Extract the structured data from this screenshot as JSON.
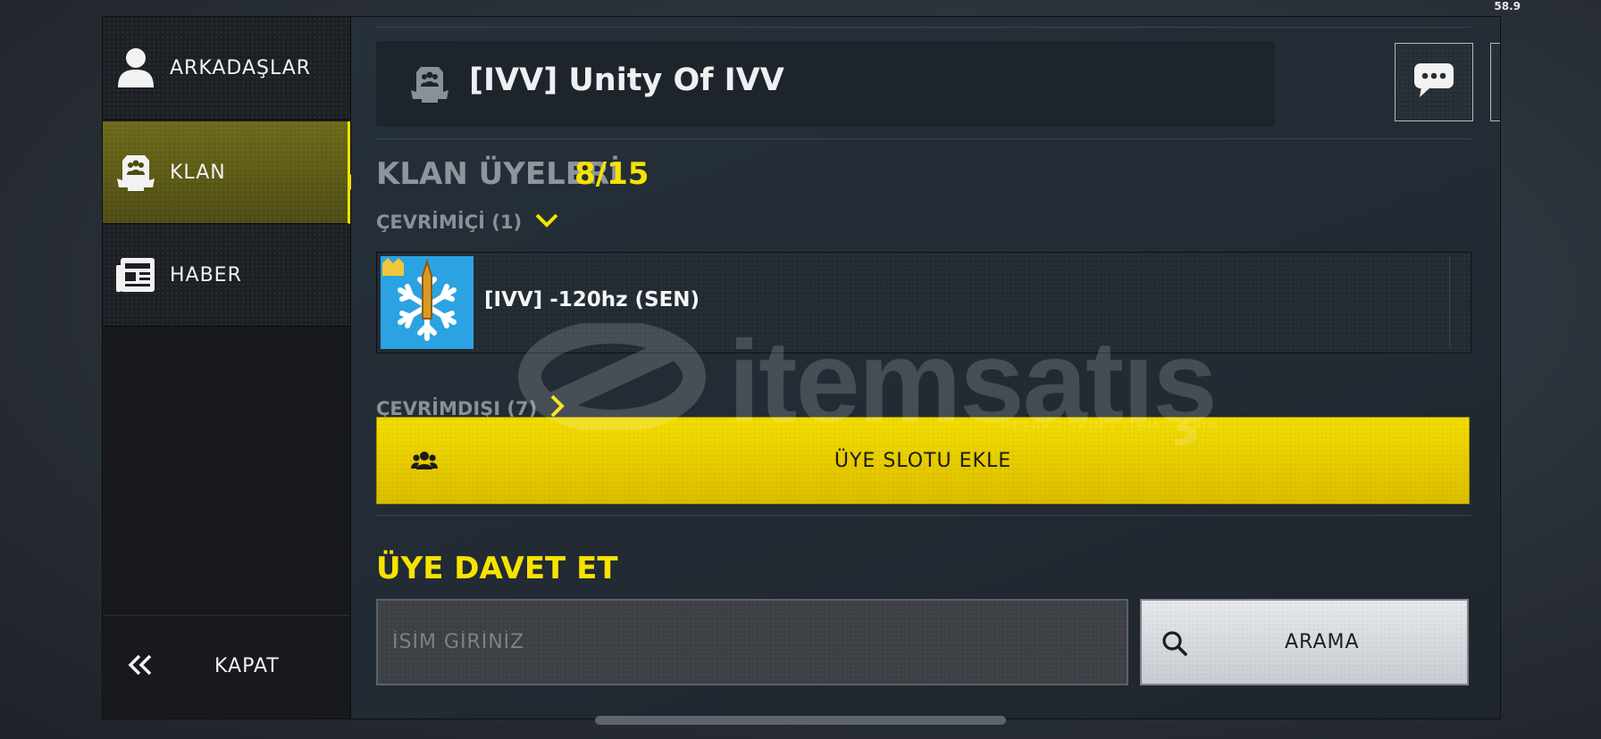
{
  "fps": "58.9",
  "sidebar": {
    "items": [
      {
        "label": "ARKADAŞLAR",
        "icon": "person-icon"
      },
      {
        "label": "KLAN",
        "icon": "clan-icon"
      },
      {
        "label": "HABER",
        "icon": "newspaper-icon"
      }
    ],
    "active_index": 1,
    "close_label": "KAPAT"
  },
  "clan": {
    "name": "[IVV] Unity Of IVV",
    "chat_icon": "chat-bubble-icon",
    "edit_icon": "pencil-icon"
  },
  "members": {
    "title": "KLAN ÜYELERİ",
    "count": "8/15",
    "online_label": "ÇEVRİMİÇİ (1)",
    "offline_label": "ÇEVRİMDIŞI (7)",
    "online_list": [
      {
        "name": "[IVV] -120hz (SEN)"
      }
    ]
  },
  "add_slot": {
    "label": "ÜYE SLOTU EKLE",
    "icon": "group-icon"
  },
  "invite": {
    "title": "ÜYE DAVET ET",
    "placeholder": "İSİM GİRİNİZ",
    "search_label": "ARAMA",
    "search_icon": "search-icon"
  },
  "watermark": {
    "text": "itemsatış",
    "subtext": "HESAP / SKIN / ITEM / E-PIN"
  },
  "colors": {
    "accent_yellow": "#f7e300",
    "active_olive": "#5c5a17",
    "panel_dark": "#1e242b"
  }
}
